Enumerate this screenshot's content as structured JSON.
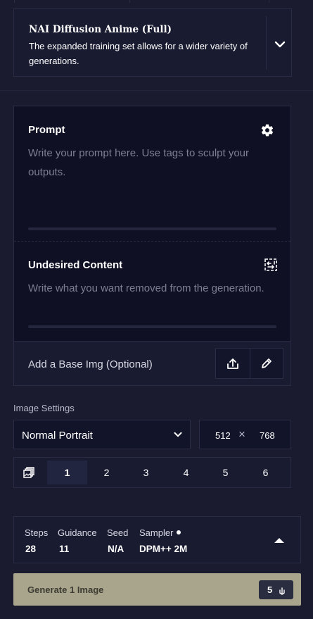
{
  "model": {
    "title": "NAI Diffusion Anime (Full)",
    "description": "The expanded training set allows for a wider variety of generations."
  },
  "prompt": {
    "label": "Prompt",
    "placeholder_line1": "Write your prompt here. Use tags to sculpt your",
    "placeholder_line2": "outputs."
  },
  "undesired": {
    "label": "Undesired Content",
    "placeholder": "Write what you want removed from the generation."
  },
  "base_image": {
    "label": "Add a Base Img (Optional)"
  },
  "image_settings": {
    "title": "Image Settings",
    "resolution_preset": "Normal Portrait",
    "width": "512",
    "height": "768",
    "separator": "×",
    "image_counts": [
      "1",
      "2",
      "3",
      "4",
      "5",
      "6"
    ],
    "selected_count": "1"
  },
  "sampling": {
    "steps_label": "Steps",
    "steps_value": "28",
    "guidance_label": "Guidance",
    "guidance_value": "11",
    "seed_label": "Seed",
    "seed_value": "N/A",
    "sampler_label": "Sampler",
    "sampler_value": "DPM++ 2M"
  },
  "generate": {
    "label": "Generate 1 Image",
    "cost": "5"
  },
  "colors": {
    "background": "#1a1b2f",
    "panel": "#191b31",
    "input": "#0f1024",
    "border": "#2a2c45",
    "generate_button": "#a8a58c"
  }
}
